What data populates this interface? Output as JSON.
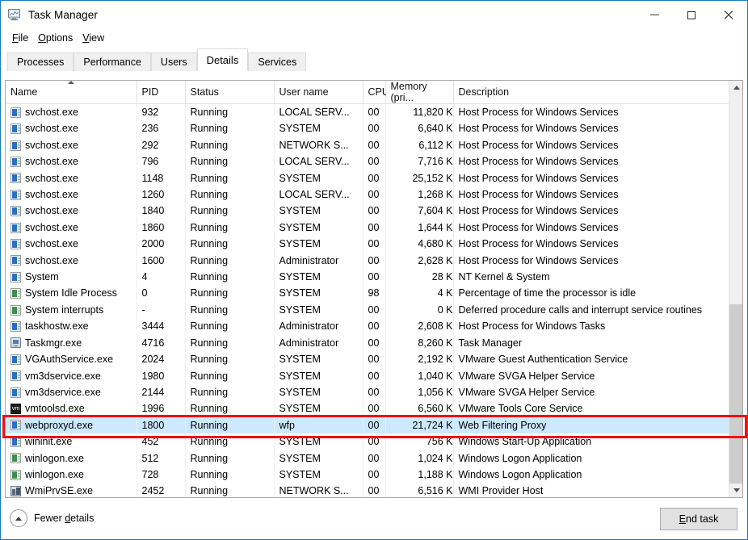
{
  "window": {
    "title": "Task Manager",
    "icon": "task-manager-icon",
    "controls": {
      "minimize": "–",
      "maximize": "☐",
      "close": "✕"
    }
  },
  "menu": {
    "items": [
      "File",
      "Options",
      "View"
    ]
  },
  "tabs": {
    "items": [
      "Processes",
      "Performance",
      "Users",
      "Details",
      "Services"
    ],
    "active": "Details"
  },
  "table": {
    "columns": [
      "Name",
      "PID",
      "Status",
      "User name",
      "CPU",
      "Memory (pri...",
      "Description"
    ],
    "sort_column": "Name",
    "sort_direction": "ascending",
    "rows": [
      {
        "icon": "blue",
        "name": "svchost.exe",
        "pid": "932",
        "status": "Running",
        "user": "LOCAL SERV...",
        "cpu": "00",
        "memory": "11,820 K",
        "description": "Host Process for Windows Services",
        "selected": false
      },
      {
        "icon": "blue",
        "name": "svchost.exe",
        "pid": "236",
        "status": "Running",
        "user": "SYSTEM",
        "cpu": "00",
        "memory": "6,640 K",
        "description": "Host Process for Windows Services",
        "selected": false
      },
      {
        "icon": "blue",
        "name": "svchost.exe",
        "pid": "292",
        "status": "Running",
        "user": "NETWORK S...",
        "cpu": "00",
        "memory": "6,112 K",
        "description": "Host Process for Windows Services",
        "selected": false
      },
      {
        "icon": "blue",
        "name": "svchost.exe",
        "pid": "796",
        "status": "Running",
        "user": "LOCAL SERV...",
        "cpu": "00",
        "memory": "7,716 K",
        "description": "Host Process for Windows Services",
        "selected": false
      },
      {
        "icon": "blue",
        "name": "svchost.exe",
        "pid": "1148",
        "status": "Running",
        "user": "SYSTEM",
        "cpu": "00",
        "memory": "25,152 K",
        "description": "Host Process for Windows Services",
        "selected": false
      },
      {
        "icon": "blue",
        "name": "svchost.exe",
        "pid": "1260",
        "status": "Running",
        "user": "LOCAL SERV...",
        "cpu": "00",
        "memory": "1,268 K",
        "description": "Host Process for Windows Services",
        "selected": false
      },
      {
        "icon": "blue",
        "name": "svchost.exe",
        "pid": "1840",
        "status": "Running",
        "user": "SYSTEM",
        "cpu": "00",
        "memory": "7,604 K",
        "description": "Host Process for Windows Services",
        "selected": false
      },
      {
        "icon": "blue",
        "name": "svchost.exe",
        "pid": "1860",
        "status": "Running",
        "user": "SYSTEM",
        "cpu": "00",
        "memory": "1,644 K",
        "description": "Host Process for Windows Services",
        "selected": false
      },
      {
        "icon": "blue",
        "name": "svchost.exe",
        "pid": "2000",
        "status": "Running",
        "user": "SYSTEM",
        "cpu": "00",
        "memory": "4,680 K",
        "description": "Host Process for Windows Services",
        "selected": false
      },
      {
        "icon": "blue",
        "name": "svchost.exe",
        "pid": "1600",
        "status": "Running",
        "user": "Administrator",
        "cpu": "00",
        "memory": "2,628 K",
        "description": "Host Process for Windows Services",
        "selected": false
      },
      {
        "icon": "blue",
        "name": "System",
        "pid": "4",
        "status": "Running",
        "user": "SYSTEM",
        "cpu": "00",
        "memory": "28 K",
        "description": "NT Kernel & System",
        "selected": false
      },
      {
        "icon": "green",
        "name": "System Idle Process",
        "pid": "0",
        "status": "Running",
        "user": "SYSTEM",
        "cpu": "98",
        "memory": "4 K",
        "description": "Percentage of time the processor is idle",
        "selected": false
      },
      {
        "icon": "green",
        "name": "System interrupts",
        "pid": "-",
        "status": "Running",
        "user": "SYSTEM",
        "cpu": "00",
        "memory": "0 K",
        "description": "Deferred procedure calls and interrupt service routines",
        "selected": false
      },
      {
        "icon": "blue",
        "name": "taskhostw.exe",
        "pid": "3444",
        "status": "Running",
        "user": "Administrator",
        "cpu": "00",
        "memory": "2,608 K",
        "description": "Host Process for Windows Tasks",
        "selected": false
      },
      {
        "icon": "taskmgr",
        "name": "Taskmgr.exe",
        "pid": "4716",
        "status": "Running",
        "user": "Administrator",
        "cpu": "00",
        "memory": "8,260 K",
        "description": "Task Manager",
        "selected": false
      },
      {
        "icon": "blue",
        "name": "VGAuthService.exe",
        "pid": "2024",
        "status": "Running",
        "user": "SYSTEM",
        "cpu": "00",
        "memory": "2,192 K",
        "description": "VMware Guest Authentication Service",
        "selected": false
      },
      {
        "icon": "blue",
        "name": "vm3dservice.exe",
        "pid": "1980",
        "status": "Running",
        "user": "SYSTEM",
        "cpu": "00",
        "memory": "1,040 K",
        "description": "VMware SVGA Helper Service",
        "selected": false
      },
      {
        "icon": "blue",
        "name": "vm3dservice.exe",
        "pid": "2144",
        "status": "Running",
        "user": "SYSTEM",
        "cpu": "00",
        "memory": "1,056 K",
        "description": "VMware SVGA Helper Service",
        "selected": false
      },
      {
        "icon": "vm",
        "name": "vmtoolsd.exe",
        "pid": "1996",
        "status": "Running",
        "user": "SYSTEM",
        "cpu": "00",
        "memory": "6,560 K",
        "description": "VMware Tools Core Service",
        "selected": false
      },
      {
        "icon": "blue",
        "name": "webproxyd.exe",
        "pid": "1800",
        "status": "Running",
        "user": "wfp",
        "cpu": "00",
        "memory": "21,724 K",
        "description": "Web Filtering Proxy",
        "selected": true
      },
      {
        "icon": "blue",
        "name": "wininit.exe",
        "pid": "452",
        "status": "Running",
        "user": "SYSTEM",
        "cpu": "00",
        "memory": "756 K",
        "description": "Windows Start-Up Application",
        "selected": false
      },
      {
        "icon": "green",
        "name": "winlogon.exe",
        "pid": "512",
        "status": "Running",
        "user": "SYSTEM",
        "cpu": "00",
        "memory": "1,024 K",
        "description": "Windows Logon Application",
        "selected": false
      },
      {
        "icon": "green",
        "name": "winlogon.exe",
        "pid": "728",
        "status": "Running",
        "user": "SYSTEM",
        "cpu": "00",
        "memory": "1,188 K",
        "description": "Windows Logon Application",
        "selected": false
      },
      {
        "icon": "wmi",
        "name": "WmiPrvSE.exe",
        "pid": "2452",
        "status": "Running",
        "user": "NETWORK S...",
        "cpu": "00",
        "memory": "6,516 K",
        "description": "WMI Provider Host",
        "selected": false
      }
    ]
  },
  "footer": {
    "fewer_details": "Fewer details",
    "end_task": "End task"
  },
  "annotation": {
    "color": "#ee1111",
    "target_row": "webproxyd.exe"
  }
}
